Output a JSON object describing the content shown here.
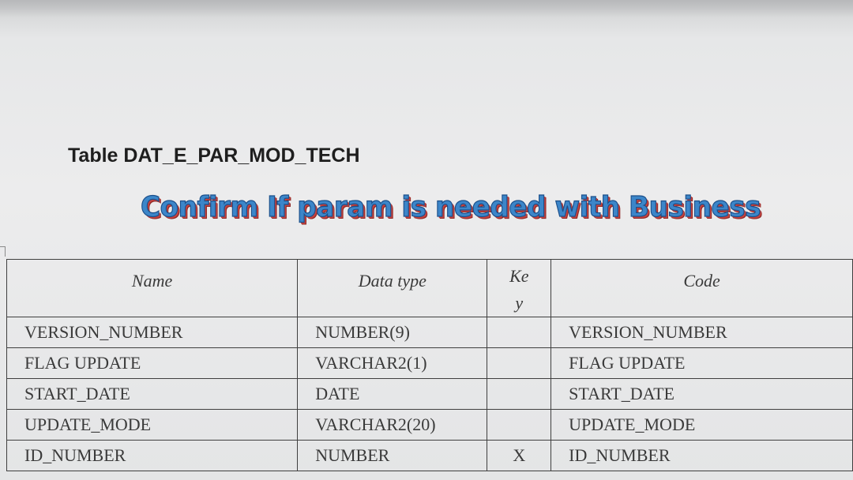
{
  "document": {
    "title": "Table DAT_E_PAR_MOD_TECH",
    "banner": "Confirm If param is needed with Business"
  },
  "table": {
    "headers": {
      "name": "Name",
      "data_type": "Data type",
      "key": "Key",
      "code": "Code"
    },
    "rows": [
      {
        "name": "VERSION_NUMBER",
        "data_type": "NUMBER(9)",
        "key": "",
        "code": "VERSION_NUMBER"
      },
      {
        "name": "FLAG UPDATE",
        "data_type": "VARCHAR2(1)",
        "key": "",
        "code": "FLAG UPDATE"
      },
      {
        "name": "START_DATE",
        "data_type": "DATE",
        "key": "",
        "code": "START_DATE"
      },
      {
        "name": "UPDATE_MODE",
        "data_type": "VARCHAR2(20)",
        "key": "",
        "code": "UPDATE_MODE"
      },
      {
        "name": "ID_NUMBER",
        "data_type": "NUMBER",
        "key": "X",
        "code": "ID_NUMBER"
      }
    ]
  }
}
